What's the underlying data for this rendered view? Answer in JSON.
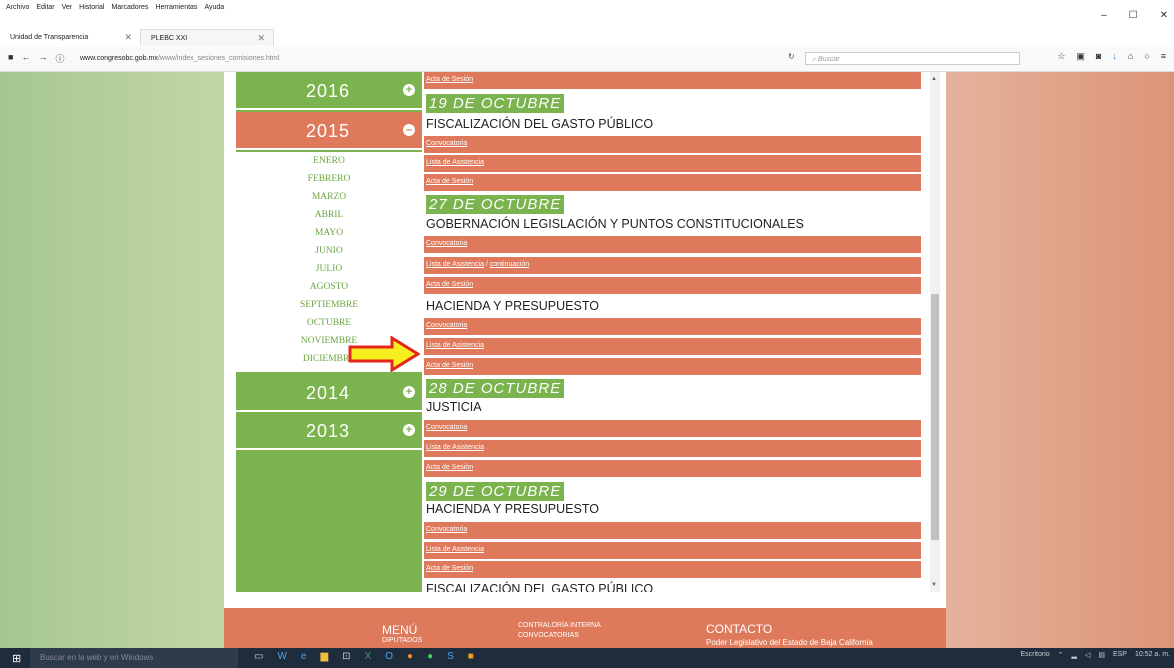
{
  "menubar": {
    "items": [
      "Archivo",
      "Editar",
      "Ver",
      "Historial",
      "Marcadores",
      "Herramientas",
      "Ayuda"
    ]
  },
  "window": {
    "minimize": "–",
    "maximize": "☐",
    "close": "✕"
  },
  "tabs": [
    {
      "label": "Unidad de Transparencia"
    },
    {
      "label": "PLEBC XXI"
    }
  ],
  "navbar": {
    "url_host": "www.congresobc.gob.mx",
    "url_path": "/www/index_sesiones_comisiones.html",
    "search_placeholder": "Buscar"
  },
  "years": {
    "y2016": "2016",
    "y2015": "2015",
    "y2014": "2014",
    "y2013": "2013",
    "months": [
      "ENERO",
      "FEBRERO",
      "MARZO",
      "ABRIL",
      "MAYO",
      "JUNIO",
      "JULIO",
      "AGOSTO",
      "SEPTIEMBRE",
      "OCTUBRE",
      "NOVIEMBRE",
      "DICIEMBRE"
    ]
  },
  "panel": {
    "acta": "Acta de Sesión",
    "convocatoria": "Convocatoria",
    "lista": "Lista de Asistencia",
    "continuacion": "continuación",
    "d19": "19 DE OCTUBRE",
    "d27": "27 DE OCTUBRE",
    "d28": "28 DE OCTUBRE",
    "d29": "29 DE OCTUBRE",
    "c_fisc": "FISCALIZACIÓN DEL GASTO PÚBLICO",
    "c_gob": "GOBERNACIÓN LEGISLACIÓN Y PUNTOS CONSTITUCIONALES",
    "c_hac": "HACIENDA Y PRESUPUESTO",
    "c_jus": "JUSTICIA"
  },
  "footer": {
    "menu": "MENÚ",
    "diputados": "DIPUTADOS",
    "contraloria": "CONTRALORÍA INTERNA",
    "convocatorias": "CONVOCATORIAS",
    "contacto": "CONTACTO",
    "poder": "Poder Legislativo del Estado de Baja California"
  },
  "taskbar": {
    "search": "Buscar en la web y en Windows",
    "desktop": "Escritorio",
    "lang": "ESP",
    "time": "10:52 a. m."
  },
  "colors": {
    "green": "#7bb34e",
    "orange": "#de7a5b"
  }
}
